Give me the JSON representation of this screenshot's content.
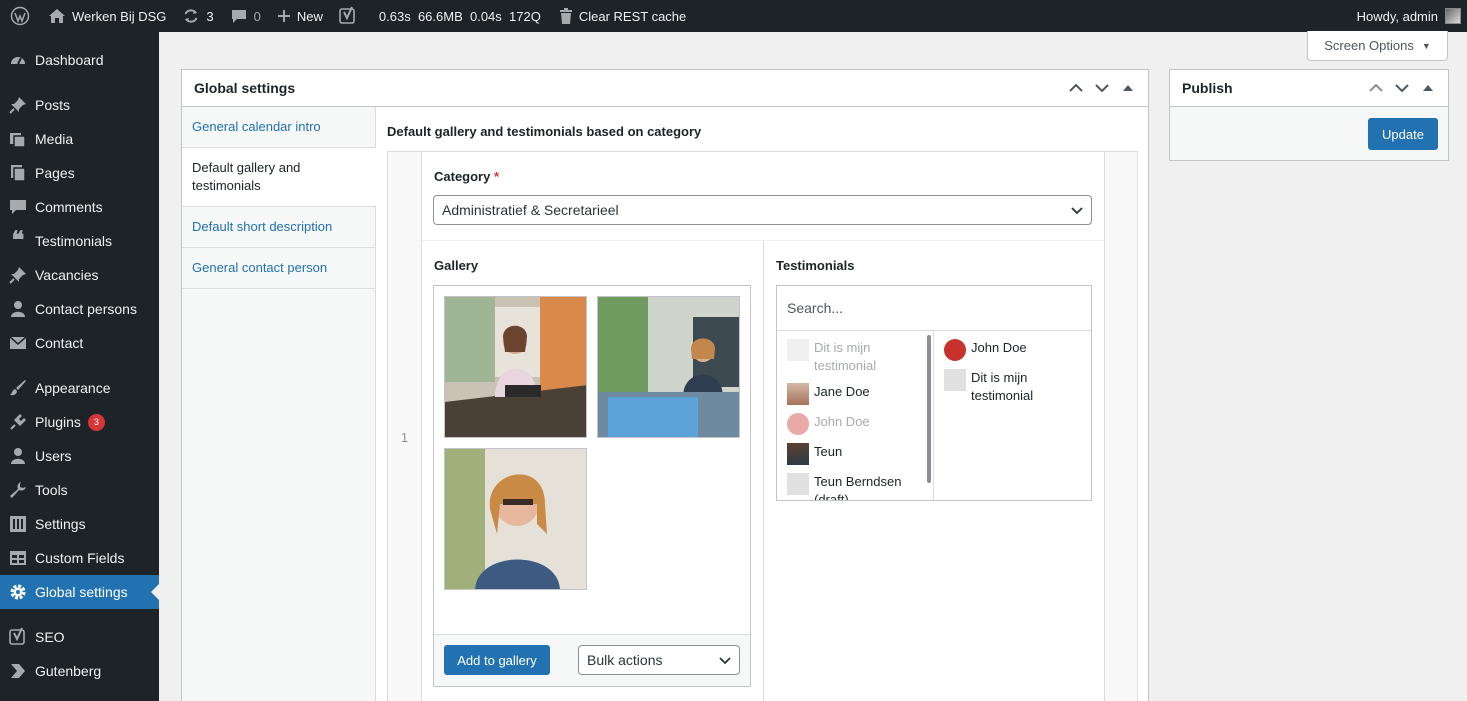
{
  "adminbar": {
    "site_name": "Werken Bij DSG",
    "updates_count": "3",
    "comments_count": "0",
    "new_label": "New",
    "perf_time": "0.63s",
    "perf_mem": "66.6MB",
    "perf_query_time": "0.04s",
    "perf_queries": "172Q",
    "clear_cache_label": "Clear REST cache",
    "howdy": "Howdy, admin"
  },
  "sidebar": {
    "items": [
      {
        "label": "Dashboard",
        "icon": "dashboard-icon"
      },
      {
        "label": "Posts",
        "icon": "pin-icon"
      },
      {
        "label": "Media",
        "icon": "media-icon"
      },
      {
        "label": "Pages",
        "icon": "pages-icon"
      },
      {
        "label": "Comments",
        "icon": "comment-icon"
      },
      {
        "label": "Testimonials",
        "icon": "quote-icon"
      },
      {
        "label": "Vacancies",
        "icon": "pin-icon"
      },
      {
        "label": "Contact persons",
        "icon": "person-icon"
      },
      {
        "label": "Contact",
        "icon": "mail-icon"
      },
      {
        "label": "Appearance",
        "icon": "brush-icon"
      },
      {
        "label": "Plugins",
        "icon": "plugin-icon",
        "badge": "3"
      },
      {
        "label": "Users",
        "icon": "users-icon"
      },
      {
        "label": "Tools",
        "icon": "wrench-icon"
      },
      {
        "label": "Settings",
        "icon": "settings-icon"
      },
      {
        "label": "Custom Fields",
        "icon": "table-icon"
      },
      {
        "label": "Global settings",
        "icon": "gear-icon"
      },
      {
        "label": "SEO",
        "icon": "yoast-icon"
      },
      {
        "label": "Gutenberg",
        "icon": "gutenberg-icon"
      }
    ]
  },
  "screen_options": "Screen Options",
  "global_box": {
    "title": "Global settings",
    "tabs": [
      "General calendar intro",
      "Default gallery and testimonials",
      "Default short description",
      "General contact person"
    ],
    "section_label": "Default gallery and testimonials based on category",
    "row_number": "1",
    "category_label": "Category",
    "required_mark": "*",
    "category_value": "Administratief & Secretarieel",
    "gallery_label": "Gallery",
    "add_to_gallery": "Add to gallery",
    "bulk_actions": "Bulk actions",
    "testimonials_label": "Testimonials",
    "search_placeholder": "Search...",
    "available": [
      {
        "label": "Dit is mijn testimonial",
        "disabled": true
      },
      {
        "label": "Jane Doe",
        "disabled": false
      },
      {
        "label": "John Doe",
        "disabled": true
      },
      {
        "label": "Teun",
        "disabled": false
      },
      {
        "label": "Teun Berndsen (draft)",
        "disabled": false
      }
    ],
    "selected": [
      {
        "label": "John Doe"
      },
      {
        "label": "Dit is mijn testimonial"
      }
    ]
  },
  "publish_box": {
    "title": "Publish",
    "update_label": "Update"
  }
}
